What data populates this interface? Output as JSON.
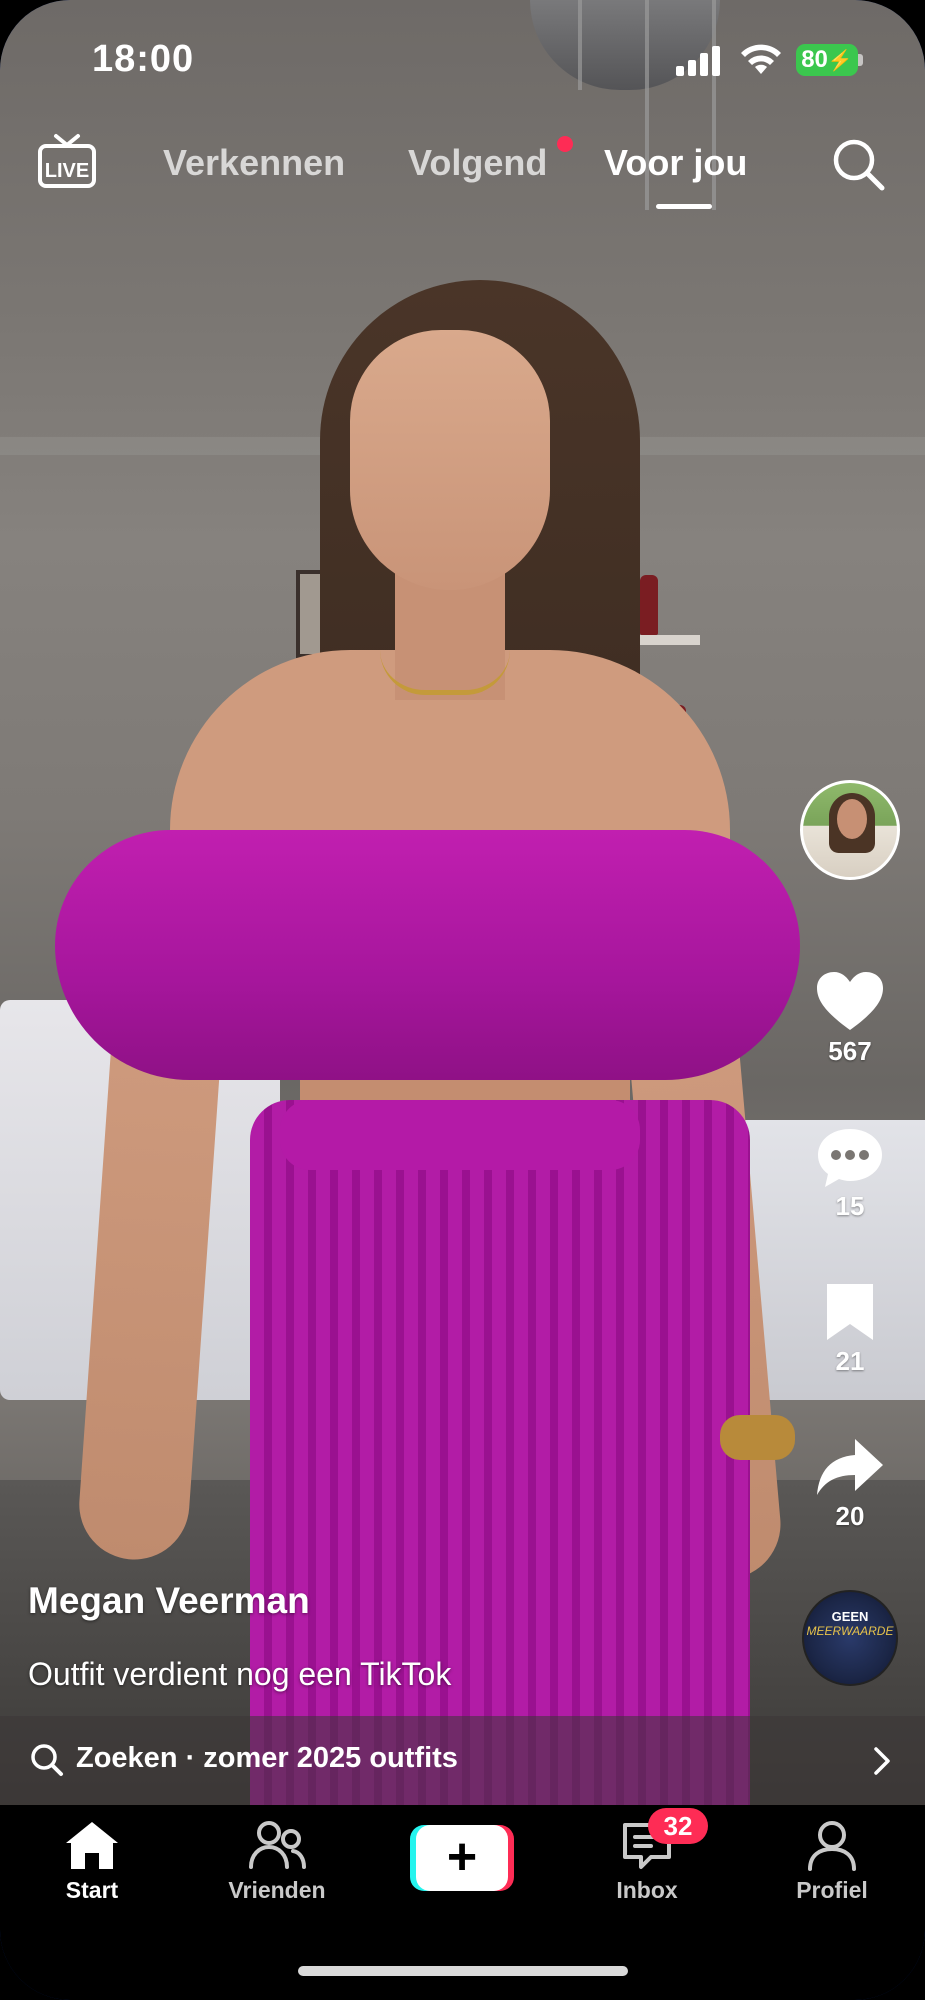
{
  "status_bar": {
    "time": "18:00",
    "battery": "80"
  },
  "top_nav": {
    "tabs": [
      {
        "label": "Verkennen"
      },
      {
        "label": "Volgend"
      },
      {
        "label": "Voor jou"
      }
    ],
    "active_tab": "Voor jou",
    "live_label": "LIVE",
    "notification_dot_color": "#fe2c55"
  },
  "rail": {
    "likes": "567",
    "comments": "15",
    "saves": "21",
    "shares": "20",
    "sound_disc_text": "GEEN",
    "sound_disc_subtext": "MEERWAARDE"
  },
  "post": {
    "author": "Megan Veerman",
    "caption": "Outfit verdient nog een TikTok"
  },
  "search_bar": {
    "text": "Zoeken · zomer 2025 outfits"
  },
  "bottom_nav": {
    "items": [
      {
        "label": "Start"
      },
      {
        "label": "Vrienden"
      },
      {
        "label": "Inbox"
      },
      {
        "label": "Profiel"
      }
    ],
    "inbox_badge": "32",
    "create_symbol": "+"
  },
  "colors": {
    "accent": "#fe2c55",
    "accent2": "#25f4ee",
    "battery": "#3bc74e"
  }
}
